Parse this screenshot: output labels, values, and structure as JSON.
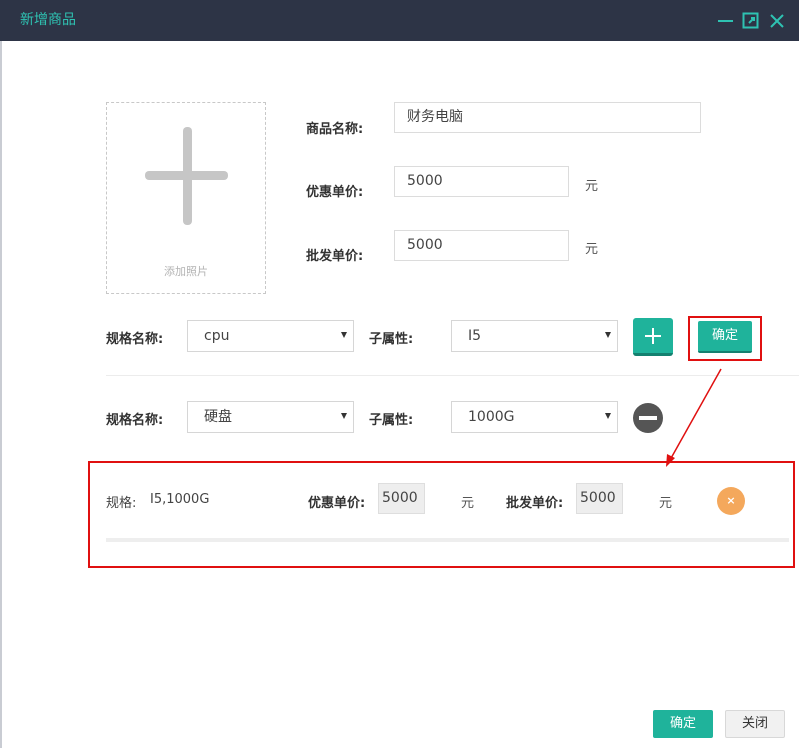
{
  "window": {
    "title": "新增商品",
    "icons": [
      "minimize-icon",
      "maximize-icon",
      "close-icon"
    ],
    "accent_color": "#2ec2b2",
    "titlebar_color": "#2d3446"
  },
  "upload": {
    "label": "添加照片",
    "icon": "plus-icon"
  },
  "product": {
    "name_label": "商品名称:",
    "name_value": "财务电脑",
    "discount_label": "优惠单价:",
    "discount_value": "5000",
    "wholesale_label": "批发单价:",
    "wholesale_value": "5000",
    "unit": "元"
  },
  "specs": [
    {
      "name_label": "规格名称:",
      "name_value": "cpu",
      "sub_label": "子属性:",
      "sub_value": "I5"
    },
    {
      "name_label": "规格名称:",
      "name_value": "硬盘",
      "sub_label": "子属性:",
      "sub_value": "1000G"
    }
  ],
  "spec_confirm_label": "确定",
  "result": {
    "spec_label": "规格:",
    "spec_value": "I5,1000G",
    "discount_label": "优惠单价:",
    "discount_value": "5000",
    "wholesale_label": "批发单价:",
    "wholesale_value": "5000",
    "unit": "元",
    "delete_symbol": "×"
  },
  "footer": {
    "ok_label": "确定",
    "close_label": "关闭"
  },
  "colors": {
    "primary": "#1fb39b",
    "highlight": "#e01010",
    "delete": "#f4a85c"
  }
}
